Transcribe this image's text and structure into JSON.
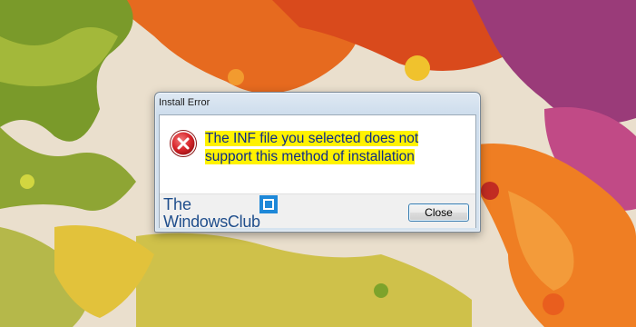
{
  "dialog": {
    "title": "Install Error",
    "icon": "error-icon",
    "message": "The INF file you selected does not support this method of installation",
    "close_label": "Close"
  },
  "watermark": {
    "line1": "The",
    "line2": "WindowsClub",
    "logo_icon": "twc-logo-icon"
  },
  "colors": {
    "message_text": "#0b2b8a",
    "message_highlight": "#fff200",
    "error_red": "#d8262b",
    "button_border": "#3c7fb1"
  }
}
